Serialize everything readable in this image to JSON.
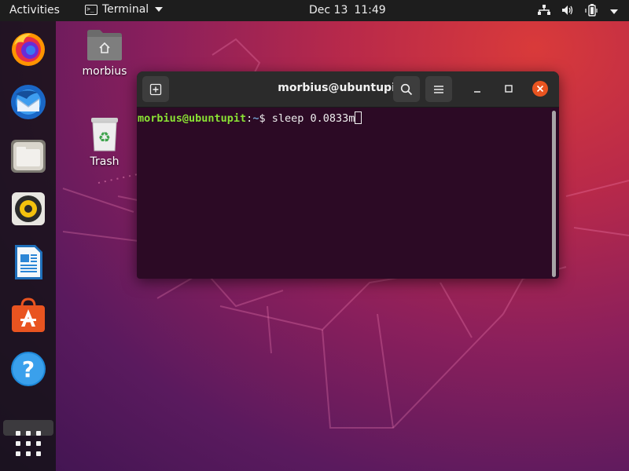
{
  "topbar": {
    "activities_label": "Activities",
    "app_name": "Terminal",
    "date": "Dec 13",
    "time": "11:49",
    "tray_icons": [
      "network-icon",
      "volume-icon",
      "battery-icon"
    ]
  },
  "dock": {
    "items": [
      "firefox-icon",
      "thunderbird-icon",
      "files-icon",
      "rhythmbox-icon",
      "libreoffice-writer-icon",
      "software-center-icon",
      "help-icon",
      "show-apps-icon"
    ]
  },
  "desktop": {
    "icons": [
      {
        "label": "morbius",
        "icon": "home-folder-icon"
      },
      {
        "label": "Trash",
        "icon": "trash-icon"
      }
    ]
  },
  "terminal": {
    "title": "morbius@ubuntupit: ~",
    "prompt_user_host": "morbius@ubuntupit",
    "prompt_colon": ":",
    "prompt_path": "~",
    "prompt_symbol": "$ ",
    "command": "sleep 0.0833m"
  },
  "colors": {
    "accent": "#e95420",
    "terminal_bg": "#2c0a25",
    "prompt_user": "#8ae234",
    "prompt_path": "#729fcf"
  }
}
